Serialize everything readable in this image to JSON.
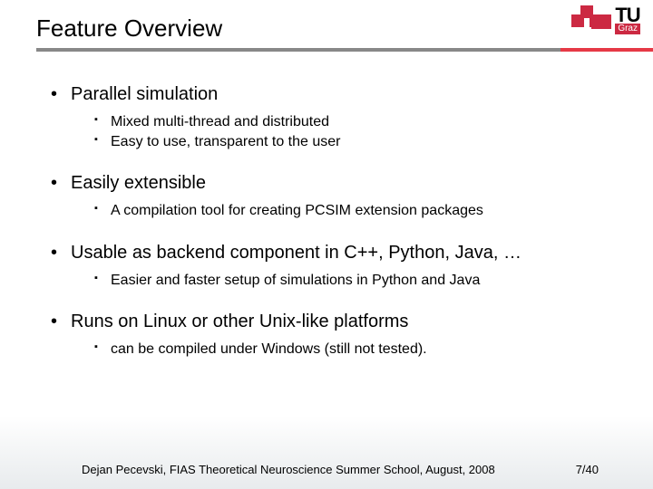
{
  "header": {
    "title": "Feature Overview",
    "logo": {
      "tu": "TU",
      "graz": "Graz"
    }
  },
  "bullets": [
    {
      "text": "Parallel simulation",
      "sub": [
        "Mixed multi-thread and distributed",
        "Easy to use, transparent to the user"
      ]
    },
    {
      "text": "Easily extensible",
      "sub": [
        "A compilation tool for creating PCSIM extension packages"
      ]
    },
    {
      "text": "Usable as backend component in C++, Python, Java, …",
      "sub": [
        "Easier and faster setup of simulations in Python and Java"
      ]
    },
    {
      "text": "Runs on Linux or other Unix-like platforms",
      "sub": [
        "can be compiled under Windows (still not tested)."
      ]
    }
  ],
  "footer": {
    "text": "Dejan Pecevski, FIAS Theoretical Neuroscience Summer School, August, 2008",
    "page": "7/40"
  }
}
